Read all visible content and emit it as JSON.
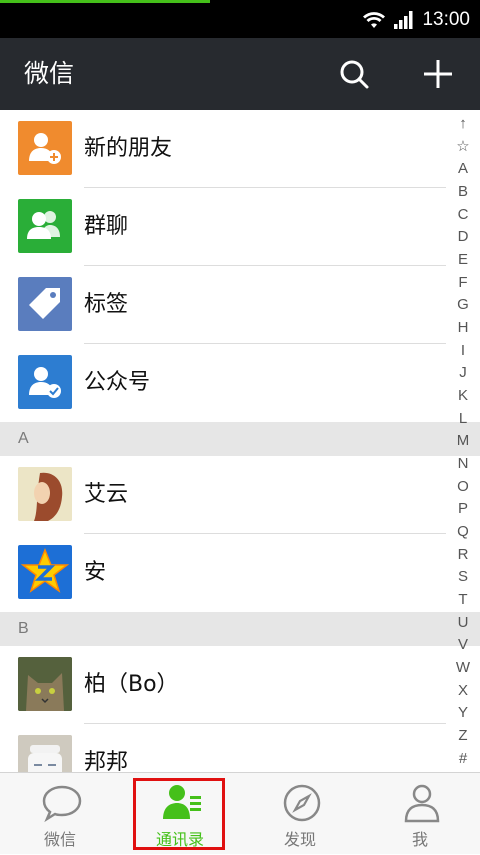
{
  "status_bar": {
    "time": "13:00"
  },
  "title_bar": {
    "title": "微信"
  },
  "special_items": [
    {
      "label": "新的朋友",
      "color": "#f08b2e",
      "icon": "add-friend-icon"
    },
    {
      "label": "群聊",
      "color": "#2aae38",
      "icon": "group-chat-icon"
    },
    {
      "label": "标签",
      "color": "#5a7dbe",
      "icon": "tag-icon"
    },
    {
      "label": "公众号",
      "color": "#2d7dd1",
      "icon": "official-account-icon"
    }
  ],
  "sections": [
    {
      "letter": "A",
      "contacts": [
        {
          "name": "艾云"
        },
        {
          "name": "安"
        }
      ]
    },
    {
      "letter": "B",
      "contacts": [
        {
          "name": "柏（Bo）"
        },
        {
          "name": "邦邦"
        }
      ]
    }
  ],
  "index_letters": [
    "↑",
    "☆",
    "A",
    "B",
    "C",
    "D",
    "E",
    "F",
    "G",
    "H",
    "I",
    "J",
    "K",
    "L",
    "M",
    "N",
    "O",
    "P",
    "Q",
    "R",
    "S",
    "T",
    "U",
    "V",
    "W",
    "X",
    "Y",
    "Z",
    "#"
  ],
  "tabs": [
    {
      "label": "微信",
      "icon": "chat-bubble-icon"
    },
    {
      "label": "通讯录",
      "icon": "contacts-icon",
      "active": true
    },
    {
      "label": "发现",
      "icon": "compass-icon"
    },
    {
      "label": "我",
      "icon": "profile-icon"
    }
  ],
  "colors": {
    "brand_green": "#45c01a",
    "title_bar": "#272a2f",
    "highlight_box": "#e01010"
  }
}
